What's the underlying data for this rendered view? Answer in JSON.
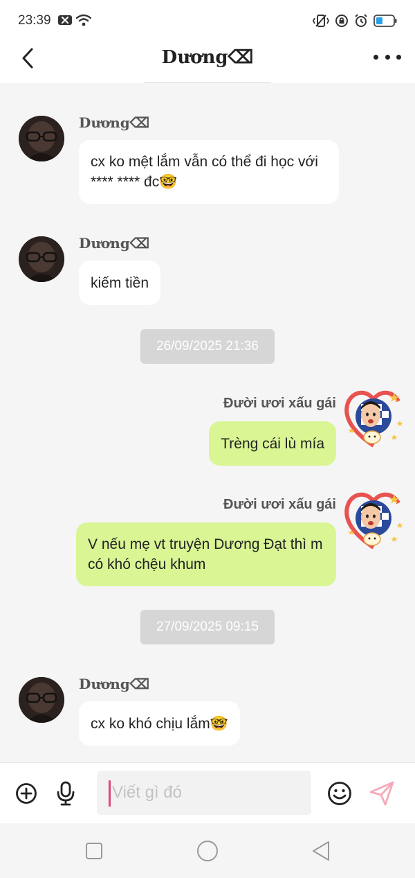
{
  "status_bar": {
    "time": "23:39"
  },
  "header": {
    "title": "Dương⌫"
  },
  "messages": [
    {
      "sender": "Dương⌫",
      "text": "cx ko mệt lắm vẫn có thể đi học với **** **** đc🤓"
    },
    {
      "sender": "Dương⌫",
      "text": "kiếm tiền"
    },
    {
      "timestamp": "26/09/2025 21:36"
    },
    {
      "sender": "Đười ươi xấu gái",
      "text": "Trèng cái lù mía"
    },
    {
      "sender": "Đười ươi xấu gái",
      "text": "V nếu mẹ vt truyện Dương Đạt thì m có khó chệu khum"
    },
    {
      "timestamp": "27/09/2025 09:15"
    },
    {
      "sender": "Dương⌫",
      "text": "cx ko khó chịu lắm🤓"
    }
  ],
  "input": {
    "placeholder": "Viết gì đó",
    "value": ""
  },
  "icons": {
    "add": "add-circle-icon",
    "mic": "microphone-icon",
    "emoji": "emoji-icon",
    "send": "send-icon",
    "nav_recent": "square-icon",
    "nav_home": "circle-icon",
    "nav_back": "triangle-back-icon"
  },
  "colors": {
    "incoming_bubble": "#ffffff",
    "outgoing_bubble": "#d9f594",
    "background": "#f5f5f5",
    "timestamp_bg": "#d6d6d6",
    "send_icon": "#f7a8b8",
    "caret": "#e0447c"
  }
}
